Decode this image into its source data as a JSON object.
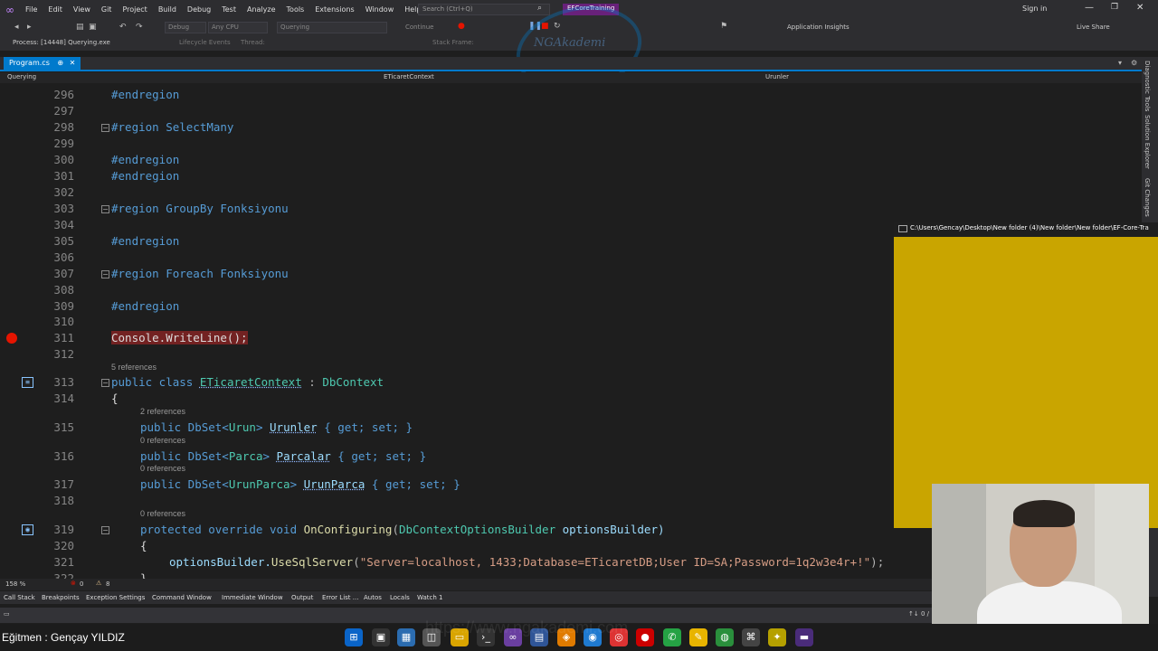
{
  "menu": [
    "File",
    "Edit",
    "View",
    "Git",
    "Project",
    "Build",
    "Debug",
    "Test",
    "Analyze",
    "Tools",
    "Extensions",
    "Window",
    "Help"
  ],
  "search": {
    "placeholder": "Search (Ctrl+Q)"
  },
  "solution_name": "EFCoreTraining",
  "signin": "Sign in",
  "toolbar": {
    "debug": "Debug",
    "cpu": "Any CPU",
    "project": "Querying",
    "continue": "Continue",
    "app_insights": "Application Insights",
    "live_share": "Live Share"
  },
  "debug_bar": {
    "process": "Process: [14448] Querying.exe",
    "lifecycle": "Lifecycle Events",
    "thread": "Thread:",
    "stack_frame": "Stack Frame:"
  },
  "watermark": "NGAkademi",
  "tab": {
    "label": "Program.cs",
    "pin": "⊕",
    "close": "✕"
  },
  "nav": {
    "project": "Querying",
    "class": "ETicaretContext",
    "member": "Urunler"
  },
  "side_tabs": [
    "Diagnostic Tools",
    "Solution Explorer",
    "Git Changes"
  ],
  "lines": [
    {
      "n": "296",
      "code": "#endregion"
    },
    {
      "n": "297",
      "code": ""
    },
    {
      "n": "298",
      "code": "#region SelectMany"
    },
    {
      "n": "299",
      "code": ""
    },
    {
      "n": "300",
      "code": "#endregion"
    },
    {
      "n": "301",
      "code": "#endregion"
    },
    {
      "n": "302",
      "code": ""
    },
    {
      "n": "303",
      "code": "#region GroupBy Fonksiyonu"
    },
    {
      "n": "304",
      "code": ""
    },
    {
      "n": "305",
      "code": "#endregion"
    },
    {
      "n": "306",
      "code": ""
    },
    {
      "n": "307",
      "code": "#region Foreach Fonksiyonu"
    },
    {
      "n": "308",
      "code": ""
    },
    {
      "n": "309",
      "code": "#endregion"
    },
    {
      "n": "310",
      "code": ""
    },
    {
      "n": "311",
      "code": "Console.WriteLine();"
    },
    {
      "n": "312",
      "code": ""
    },
    {
      "n": "313",
      "ref": "5 references",
      "p": [
        "public class ",
        "ETicaretContext",
        " : ",
        "DbContext"
      ]
    },
    {
      "n": "314",
      "code": "{"
    },
    {
      "n": "315",
      "ref": "2 references",
      "p": [
        "public DbSet<",
        "Urun",
        "> ",
        "Urunler",
        " { get; set; }"
      ]
    },
    {
      "n": "316",
      "ref": "0 references",
      "p": [
        "public DbSet<",
        "Parca",
        "> ",
        "Parcalar",
        " { get; set; }"
      ]
    },
    {
      "n": "317",
      "ref": "0 references",
      "p": [
        "public DbSet<",
        "UrunParca",
        "> ",
        "UrunParca",
        " { get; set; }"
      ]
    },
    {
      "n": "318",
      "code": ""
    },
    {
      "n": "319",
      "ref": "0 references",
      "p": [
        "protected override void ",
        "OnConfiguring",
        "(",
        "DbContextOptionsBuilder",
        " optionsBuilder)"
      ]
    },
    {
      "n": "320",
      "code": "{"
    },
    {
      "n": "321",
      "p": [
        "optionsBuilder.",
        "UseSqlServer",
        "(",
        "\"Server=localhost, 1433;Database=ETicaretDB;User ID=SA;Password=1q2w3e4r+!\"",
        ");"
      ]
    },
    {
      "n": "322",
      "code": "}"
    }
  ],
  "console_title": "C:\\Users\\Gencay\\Desktop\\New folder (4)\\New folder\\New folder\\EF-Core-Tra",
  "status": {
    "zoom": "158 %",
    "errors": "0",
    "warnings": "8"
  },
  "bottom_tabs": [
    "Call Stack",
    "Breakpoints",
    "Exception Settings",
    "Command Window",
    "Immediate Window",
    "Output",
    "Error List ...",
    "Autos",
    "Locals",
    "Watch 1"
  ],
  "statusbar": {
    "position": "↑↓ 0 /"
  },
  "instructor": "Eğitmen : Gençay YILDIZ",
  "taskbar_url": "https://www.ngakademi.com",
  "colors": {
    "accent": "#007acc",
    "console_bg": "#c9a500",
    "breakpoint": "#e51400",
    "vs_purple": "#68217a"
  }
}
